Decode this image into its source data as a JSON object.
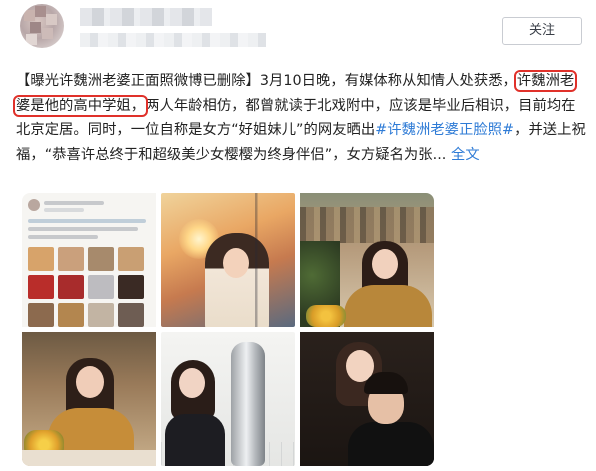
{
  "header": {
    "follow_label": "关注"
  },
  "post": {
    "segment_1": "【曝光许魏洲老婆正面照微博已删除】3月10日晚，有媒体称从知情人处获悉，",
    "segment_highlight": "许魏洲老婆是他的高中学姐，",
    "segment_2": "两人年龄相仿，都曾就读于北戏附中，应该是毕业后相识，目前均在北京定居。同时，一位自称是女方“好姐妹儿”的网友晒出",
    "hashtag": "#许魏洲老婆正脸照#",
    "segment_3": "，并送上祝福，“恭喜许总终于和超级美少女樱樱为终身伴侣”，女方疑名为张...",
    "expand_label": "全文"
  },
  "colors": {
    "link": "#2e7bd6",
    "highlight_box": "#e0312a",
    "text": "#222222"
  },
  "photos": [
    {
      "name": "photo-screenshot-post"
    },
    {
      "name": "photo-woman-sunset-window"
    },
    {
      "name": "photo-woman-bookshelf"
    },
    {
      "name": "photo-woman-cafe"
    },
    {
      "name": "photo-woman-statue"
    },
    {
      "name": "photo-couple-selfie"
    }
  ]
}
